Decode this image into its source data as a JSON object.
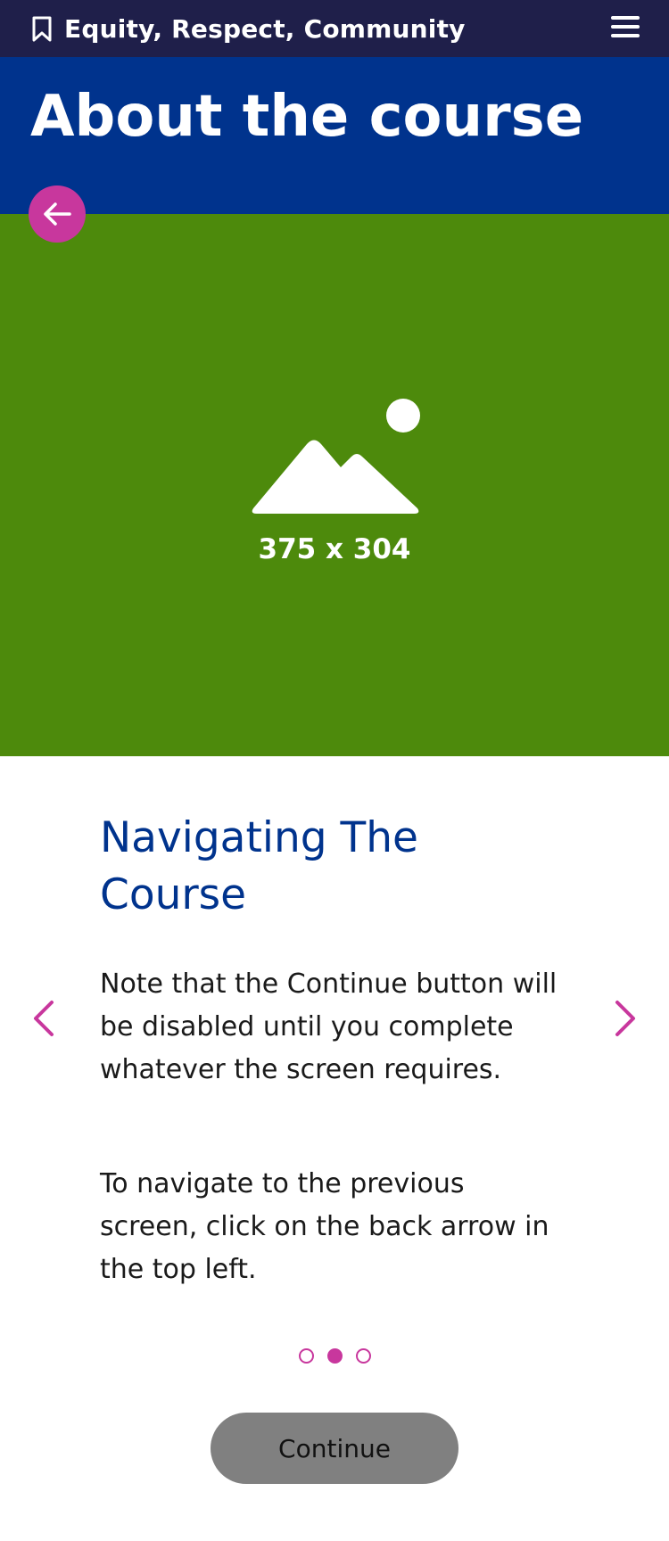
{
  "topbar": {
    "course_title": "Equity, Respect, Community",
    "bookmark_icon": "bookmark-icon",
    "menu_icon": "hamburger-menu-icon"
  },
  "header": {
    "page_title": "About the course",
    "background_color": "#00338d"
  },
  "hero": {
    "placeholder_label": "375 x 304",
    "placeholder_icon": "image-placeholder-icon",
    "background_color": "#4d8a0c"
  },
  "back_button": {
    "icon": "arrow-left-icon",
    "color": "#c8379d"
  },
  "content": {
    "section_title": "Navigating The Course",
    "paragraphs": [
      "Note that the Continue button will be disabled until you complete whatever the screen requires.",
      "To navigate to the previous screen, click on the back arrow in the top left."
    ]
  },
  "carousel": {
    "prev_icon": "chevron-left-icon",
    "next_icon": "chevron-right-icon",
    "total_slides": 3,
    "active_slide": 2,
    "accent_color": "#c8379d"
  },
  "continue_button": {
    "label": "Continue",
    "disabled": true
  }
}
